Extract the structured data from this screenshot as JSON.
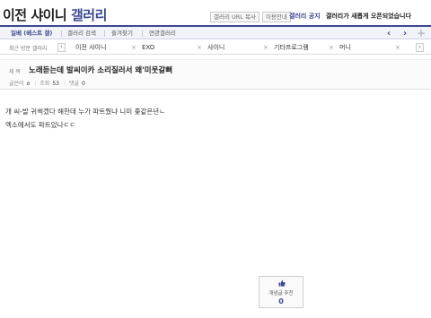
{
  "header": {
    "title_part1": "이전 샤이니",
    "title_part2": "갤러리",
    "copy_url_label": "갤러리 URL 복사",
    "usage_guide_label": "이용안내",
    "notice_label": "갤러리 공지",
    "notice_text": "갤러리가 새롭게 오픈되었습니다"
  },
  "tabs": [
    {
      "label": "일베 (베스트 갤)",
      "active": true
    },
    {
      "label": "갤러리 검색"
    },
    {
      "label": "즐겨찾기"
    },
    {
      "label": "연관갤러리"
    }
  ],
  "nav": {
    "prev": "‹",
    "next": "›",
    "add": "+"
  },
  "recent": {
    "label": "최근 방문 갤러리",
    "prev": "‹",
    "next": "›",
    "items": [
      "이전 샤이니",
      "EXO",
      "샤이니",
      "기타프로그램",
      "머니"
    ],
    "remove": "×"
  },
  "post": {
    "subject_label": "제 목",
    "subject": "노래듣는데 발씨이카 소리질러서 왜'미웃갈뻐",
    "author_label": "글쓴이",
    "author_value": "o",
    "views_label": "조회",
    "views": "53",
    "replies_label": "댓글",
    "replies": "0",
    "body": [
      "개 씨-발 귀썩겠다 해한데 누가 파트줬냐 니미 좇같은년ㄴ",
      "엑소에서도 파트있나ㄷㄷ"
    ]
  },
  "recommend": {
    "label": "개념글 추천",
    "count": "0"
  },
  "colors": {
    "accent": "#3b4890"
  }
}
